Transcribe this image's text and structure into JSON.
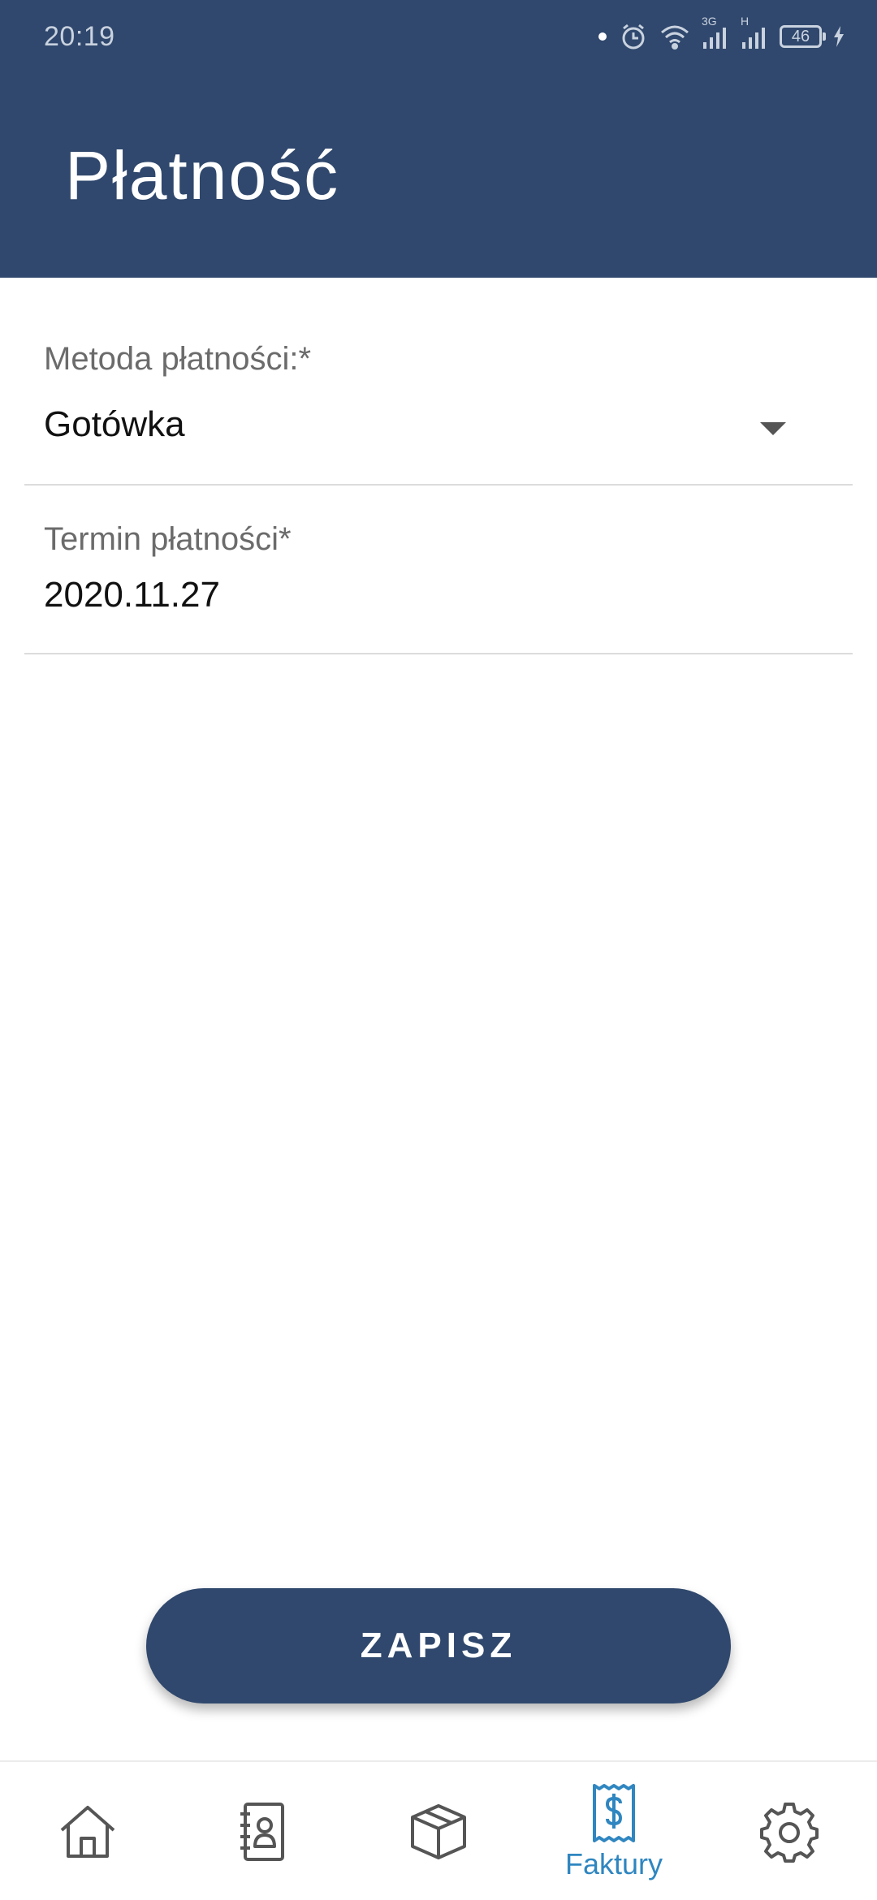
{
  "status_bar": {
    "time": "20:19",
    "battery_level": "46",
    "network_labels": [
      "3G",
      "H"
    ]
  },
  "header": {
    "title": "Płatność",
    "background_color": "#30486d"
  },
  "form": {
    "payment_method": {
      "label": "Metoda płatności:*",
      "value": "Gotówka"
    },
    "payment_due": {
      "label": "Termin płatności*",
      "value": "2020.11.27"
    }
  },
  "actions": {
    "save_label": "ZAPISZ"
  },
  "bottom_nav": {
    "active_color": "#2f86c0",
    "inactive_color": "#555555",
    "items": [
      {
        "icon": "home-icon",
        "label": "",
        "active": false
      },
      {
        "icon": "contacts-icon",
        "label": "",
        "active": false
      },
      {
        "icon": "box-icon",
        "label": "",
        "active": false
      },
      {
        "icon": "invoice-icon",
        "label": "Faktury",
        "active": true
      },
      {
        "icon": "gear-icon",
        "label": "",
        "active": false
      }
    ]
  }
}
